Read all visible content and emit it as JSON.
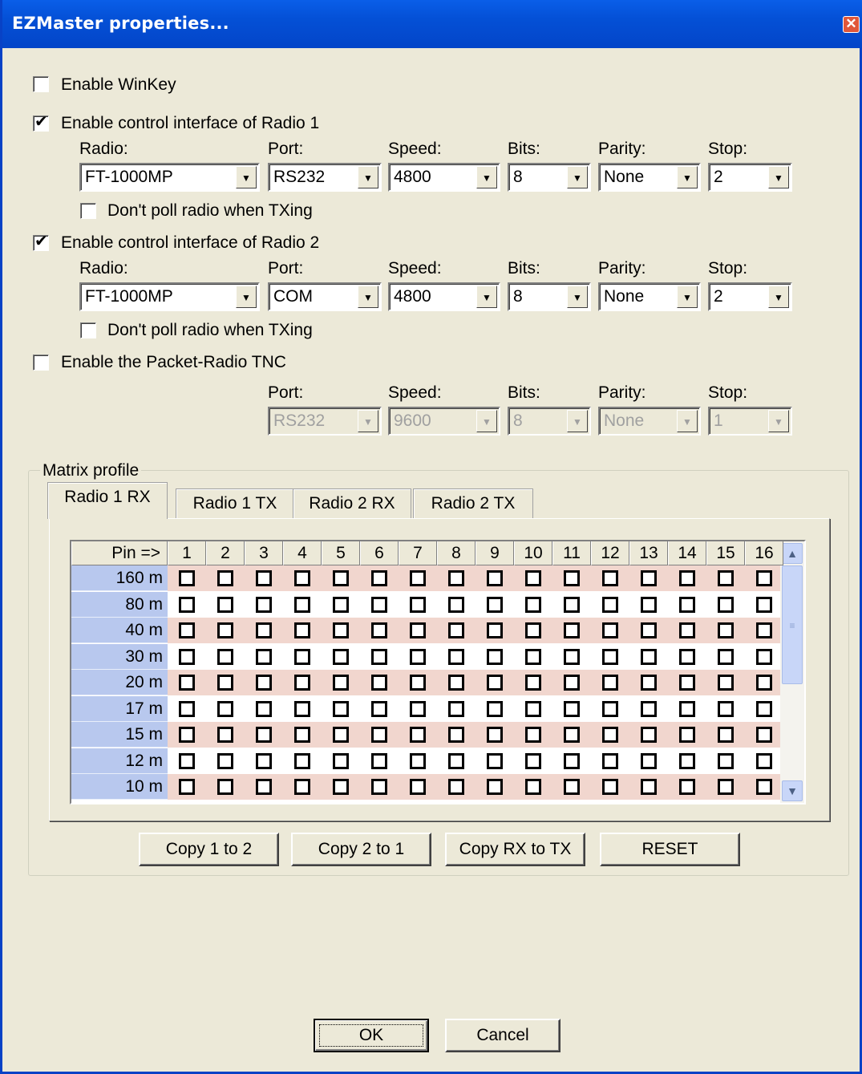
{
  "window": {
    "title": "EZMaster properties..."
  },
  "winkey": {
    "label": "Enable WinKey",
    "checked": false
  },
  "radio1": {
    "label": "Enable control interface of Radio 1",
    "checked": true,
    "radio": "FT-1000MP",
    "port": "RS232",
    "speed": "4800",
    "bits": "8",
    "parity": "None",
    "stop": "2",
    "nopoll_label": "Don't poll radio when TXing",
    "nopoll_checked": false
  },
  "radio2": {
    "label": "Enable control interface of Radio 2",
    "checked": true,
    "radio": "FT-1000MP",
    "port": "COM",
    "speed": "4800",
    "bits": "8",
    "parity": "None",
    "stop": "2",
    "nopoll_label": "Don't poll radio when TXing",
    "nopoll_checked": false
  },
  "tnc": {
    "label": "Enable the Packet-Radio TNC",
    "checked": false,
    "port": "RS232",
    "speed": "9600",
    "bits": "8",
    "parity": "None",
    "stop": "1"
  },
  "headers": {
    "radio": "Radio:",
    "port": "Port:",
    "speed": "Speed:",
    "bits": "Bits:",
    "parity": "Parity:",
    "stop": "Stop:"
  },
  "matrix": {
    "group_label": "Matrix profile",
    "tabs": [
      "Radio 1 RX",
      "Radio 1 TX",
      "Radio 2 RX",
      "Radio 2 TX"
    ],
    "active_tab": 0,
    "pin_header": "Pin =>",
    "pins": [
      "1",
      "2",
      "3",
      "4",
      "5",
      "6",
      "7",
      "8",
      "9",
      "10",
      "11",
      "12",
      "13",
      "14",
      "15",
      "16"
    ],
    "bands": [
      "160 m",
      "80 m",
      "40 m",
      "30 m",
      "20 m",
      "17 m",
      "15 m",
      "12 m",
      "10 m"
    ],
    "row_colors": [
      "#f1d6ce",
      "#ffffff"
    ],
    "header_color": "#b8c8ee"
  },
  "actions": {
    "copy12": "Copy 1 to 2",
    "copy21": "Copy 2 to 1",
    "copyrxtx": "Copy RX to TX",
    "reset": "RESET"
  },
  "footer": {
    "ok": "OK",
    "cancel": "Cancel"
  }
}
